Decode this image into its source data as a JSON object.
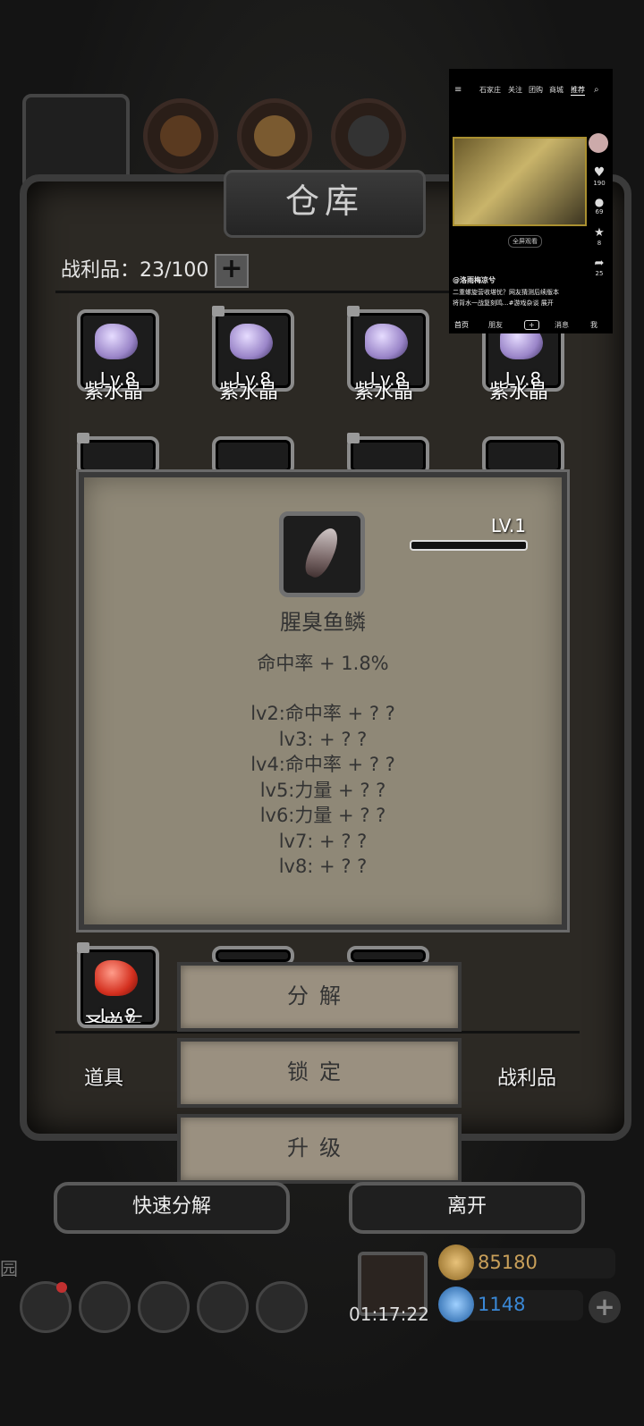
{
  "warehouse": {
    "title": "仓库",
    "loot_count": "战利品：23/100",
    "add_symbol": "+"
  },
  "items": [
    {
      "level": "Lv.8",
      "name": "紫水晶",
      "type": "amethyst"
    },
    {
      "level": "Lv.8",
      "name": "紫水晶",
      "type": "amethyst"
    },
    {
      "level": "Lv.8",
      "name": "紫水晶",
      "type": "amethyst"
    },
    {
      "level": "Lv.8",
      "name": "紫水晶",
      "type": "amethyst"
    },
    {
      "level": "Lv.8",
      "name": "圣安石",
      "type": "red-stone"
    }
  ],
  "popup": {
    "level": "LV.1",
    "name": "腥臭鱼鳞",
    "stat": "命中率 + 1.8%",
    "levels": [
      "lv2:命中率 + ? ?",
      "lv3: + ? ?",
      "lv4:命中率 + ? ?",
      "lv5:力量 + ? ?",
      "lv6:力量 + ? ?",
      "lv7: + ? ?",
      "lv8: + ? ?"
    ]
  },
  "actions": {
    "decompose": "分解",
    "lock": "锁定",
    "upgrade": "升级"
  },
  "tabs": {
    "items": "道具",
    "loot": "战利品"
  },
  "bottom": {
    "quick_decompose": "快速分解",
    "leave": "离开"
  },
  "hud": {
    "timer": "01:17:22",
    "gold": "85180",
    "gems": "1148",
    "side_text": "园"
  },
  "overlay": {
    "nav": [
      "石家庄",
      "关注",
      "团购",
      "商城",
      "推荐"
    ],
    "author": "@洛雨梅凉兮",
    "desc_line1": "二重螺旋营收堪忧？网友猜测后续版本",
    "desc_line2": "将背水一战复刻鸣...#游戏杂谈  展开",
    "fullscreen": "全屏观看",
    "likes": "190",
    "comments": "69",
    "stars": "8",
    "shares": "25",
    "tabs": [
      "首页",
      "朋友",
      "+",
      "消息",
      "我"
    ]
  },
  "colors": {
    "popup_bg": "#8f8877",
    "gold": "#c9a05a",
    "gem_blue": "#3a88d6"
  }
}
